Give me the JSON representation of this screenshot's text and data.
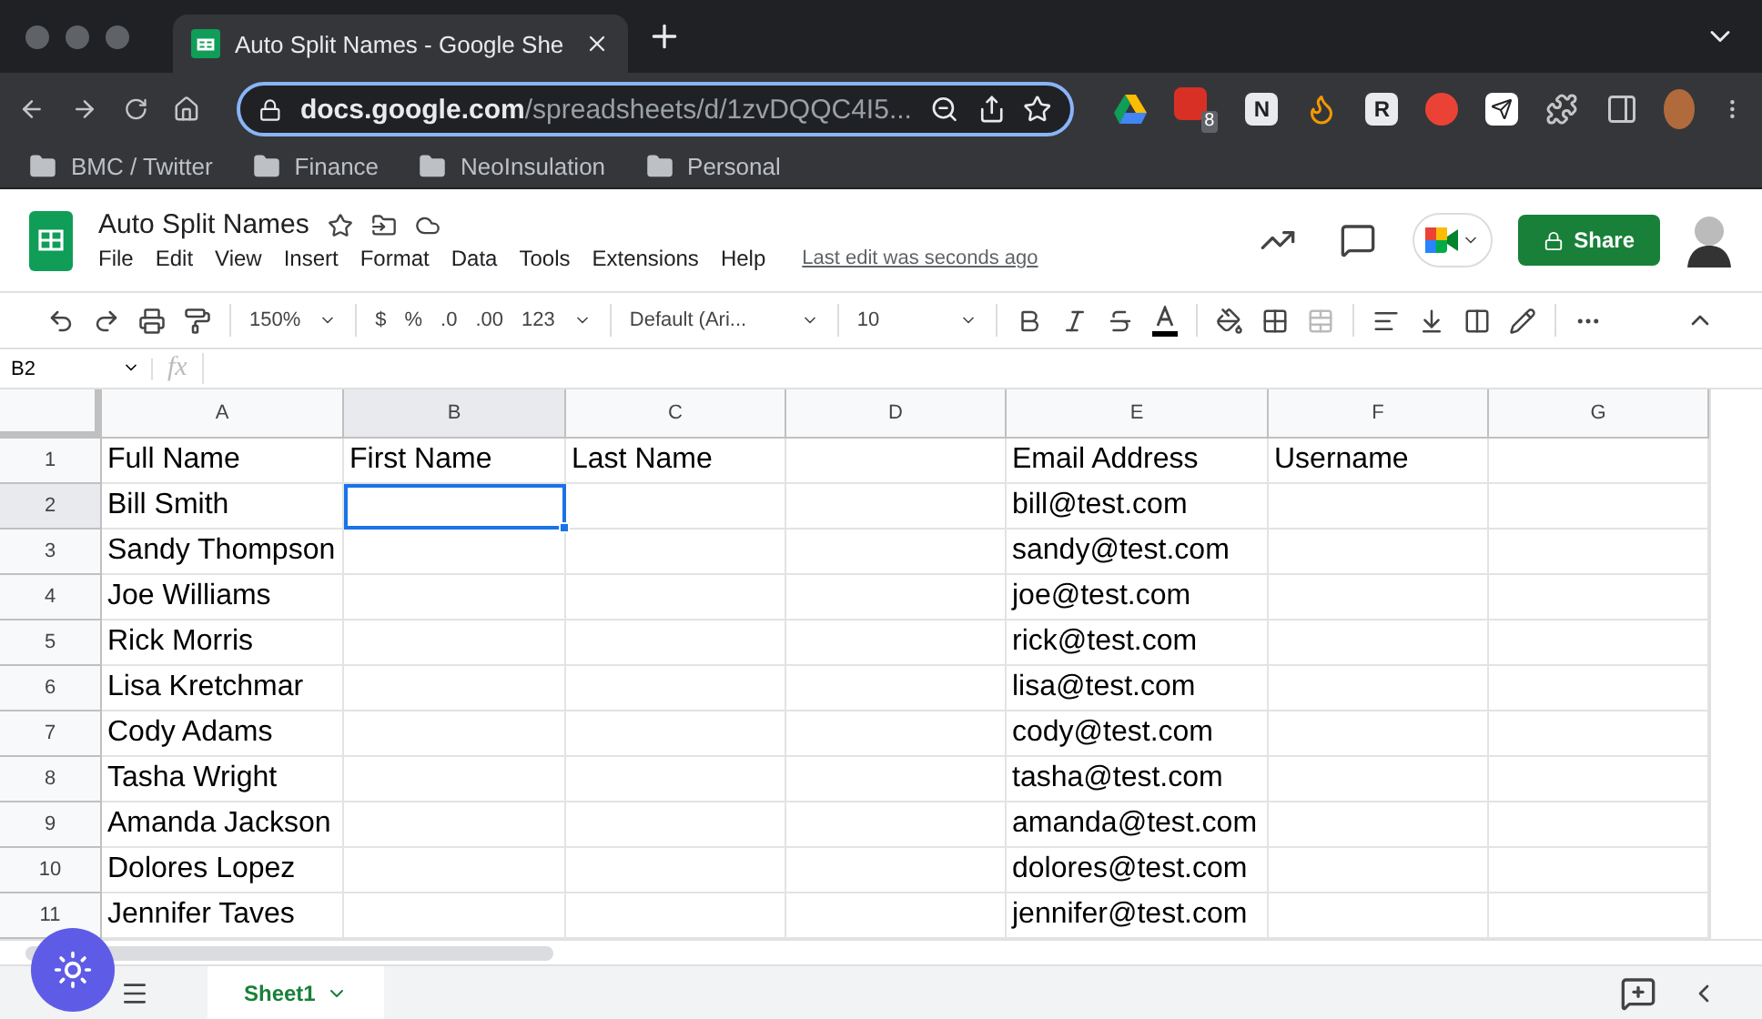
{
  "browser": {
    "tab": {
      "title": "Auto Split Names - Google She",
      "selected": true
    },
    "address": {
      "host": "docs.google.com",
      "path": "/spreadsheets/d/1zvDQQC4I5..."
    },
    "extensions": [
      {
        "kind": "drive"
      },
      {
        "kind": "badge",
        "badge": "8"
      },
      {
        "kind": "letter",
        "letter": "N"
      },
      {
        "kind": "flame"
      },
      {
        "kind": "letter",
        "letter": "R"
      },
      {
        "kind": "red"
      },
      {
        "kind": "send"
      },
      {
        "kind": "puzzle"
      },
      {
        "kind": "panel"
      }
    ],
    "bookmarks": [
      "BMC / Twitter",
      "Finance",
      "NeoInsulation",
      "Personal"
    ]
  },
  "doc": {
    "title": "Auto Split Names",
    "menu": [
      "File",
      "Edit",
      "View",
      "Insert",
      "Format",
      "Data",
      "Tools",
      "Extensions",
      "Help"
    ],
    "last_edit": "Last edit was seconds ago",
    "share": "Share"
  },
  "toolbar": {
    "zoom": "150%",
    "currency": "$",
    "percent": "%",
    "decrease_decimals": ".0",
    "increase_decimals": ".00",
    "number_format": "123",
    "font": "Default (Ari...",
    "font_size": "10"
  },
  "formula_bar": {
    "cell_ref": "B2",
    "fx": "fx"
  },
  "columns": [
    {
      "label": "A",
      "selected": false
    },
    {
      "label": "B",
      "selected": true
    },
    {
      "label": "C",
      "selected": false
    },
    {
      "label": "D",
      "selected": false
    },
    {
      "label": "E",
      "selected": false
    },
    {
      "label": "F",
      "selected": false
    },
    {
      "label": "G",
      "selected": false
    }
  ],
  "rows": [
    {
      "number": "1",
      "selected": false,
      "cells": [
        "Full Name",
        "First Name",
        "Last Name",
        null,
        "Email Address",
        "Username",
        null
      ]
    },
    {
      "number": "2",
      "selected": true,
      "cells": [
        "Bill Smith",
        null,
        null,
        null,
        "bill@test.com",
        null,
        null
      ]
    },
    {
      "number": "3",
      "selected": false,
      "cells": [
        "Sandy Thompson",
        null,
        null,
        null,
        "sandy@test.com",
        null,
        null
      ]
    },
    {
      "number": "4",
      "selected": false,
      "cells": [
        "Joe Williams",
        null,
        null,
        null,
        "joe@test.com",
        null,
        null
      ]
    },
    {
      "number": "5",
      "selected": false,
      "cells": [
        "Rick Morris",
        null,
        null,
        null,
        "rick@test.com",
        null,
        null
      ]
    },
    {
      "number": "6",
      "selected": false,
      "cells": [
        "Lisa Kretchmar",
        null,
        null,
        null,
        "lisa@test.com",
        null,
        null
      ]
    },
    {
      "number": "7",
      "selected": false,
      "cells": [
        "Cody Adams",
        null,
        null,
        null,
        "cody@test.com",
        null,
        null
      ]
    },
    {
      "number": "8",
      "selected": false,
      "cells": [
        "Tasha Wright",
        null,
        null,
        null,
        "tasha@test.com",
        null,
        null
      ]
    },
    {
      "number": "9",
      "selected": false,
      "cells": [
        "Amanda Jackson",
        null,
        null,
        null,
        "amanda@test.com",
        null,
        null
      ]
    },
    {
      "number": "10",
      "selected": false,
      "cells": [
        "Dolores Lopez",
        null,
        null,
        null,
        "dolores@test.com",
        null,
        null
      ]
    },
    {
      "number": "11",
      "selected": false,
      "cells": [
        "Jennifer Taves",
        null,
        null,
        null,
        "jennifer@test.com",
        null,
        null
      ]
    }
  ],
  "sheets": [
    {
      "name": "Sheet1",
      "selected": true
    }
  ]
}
